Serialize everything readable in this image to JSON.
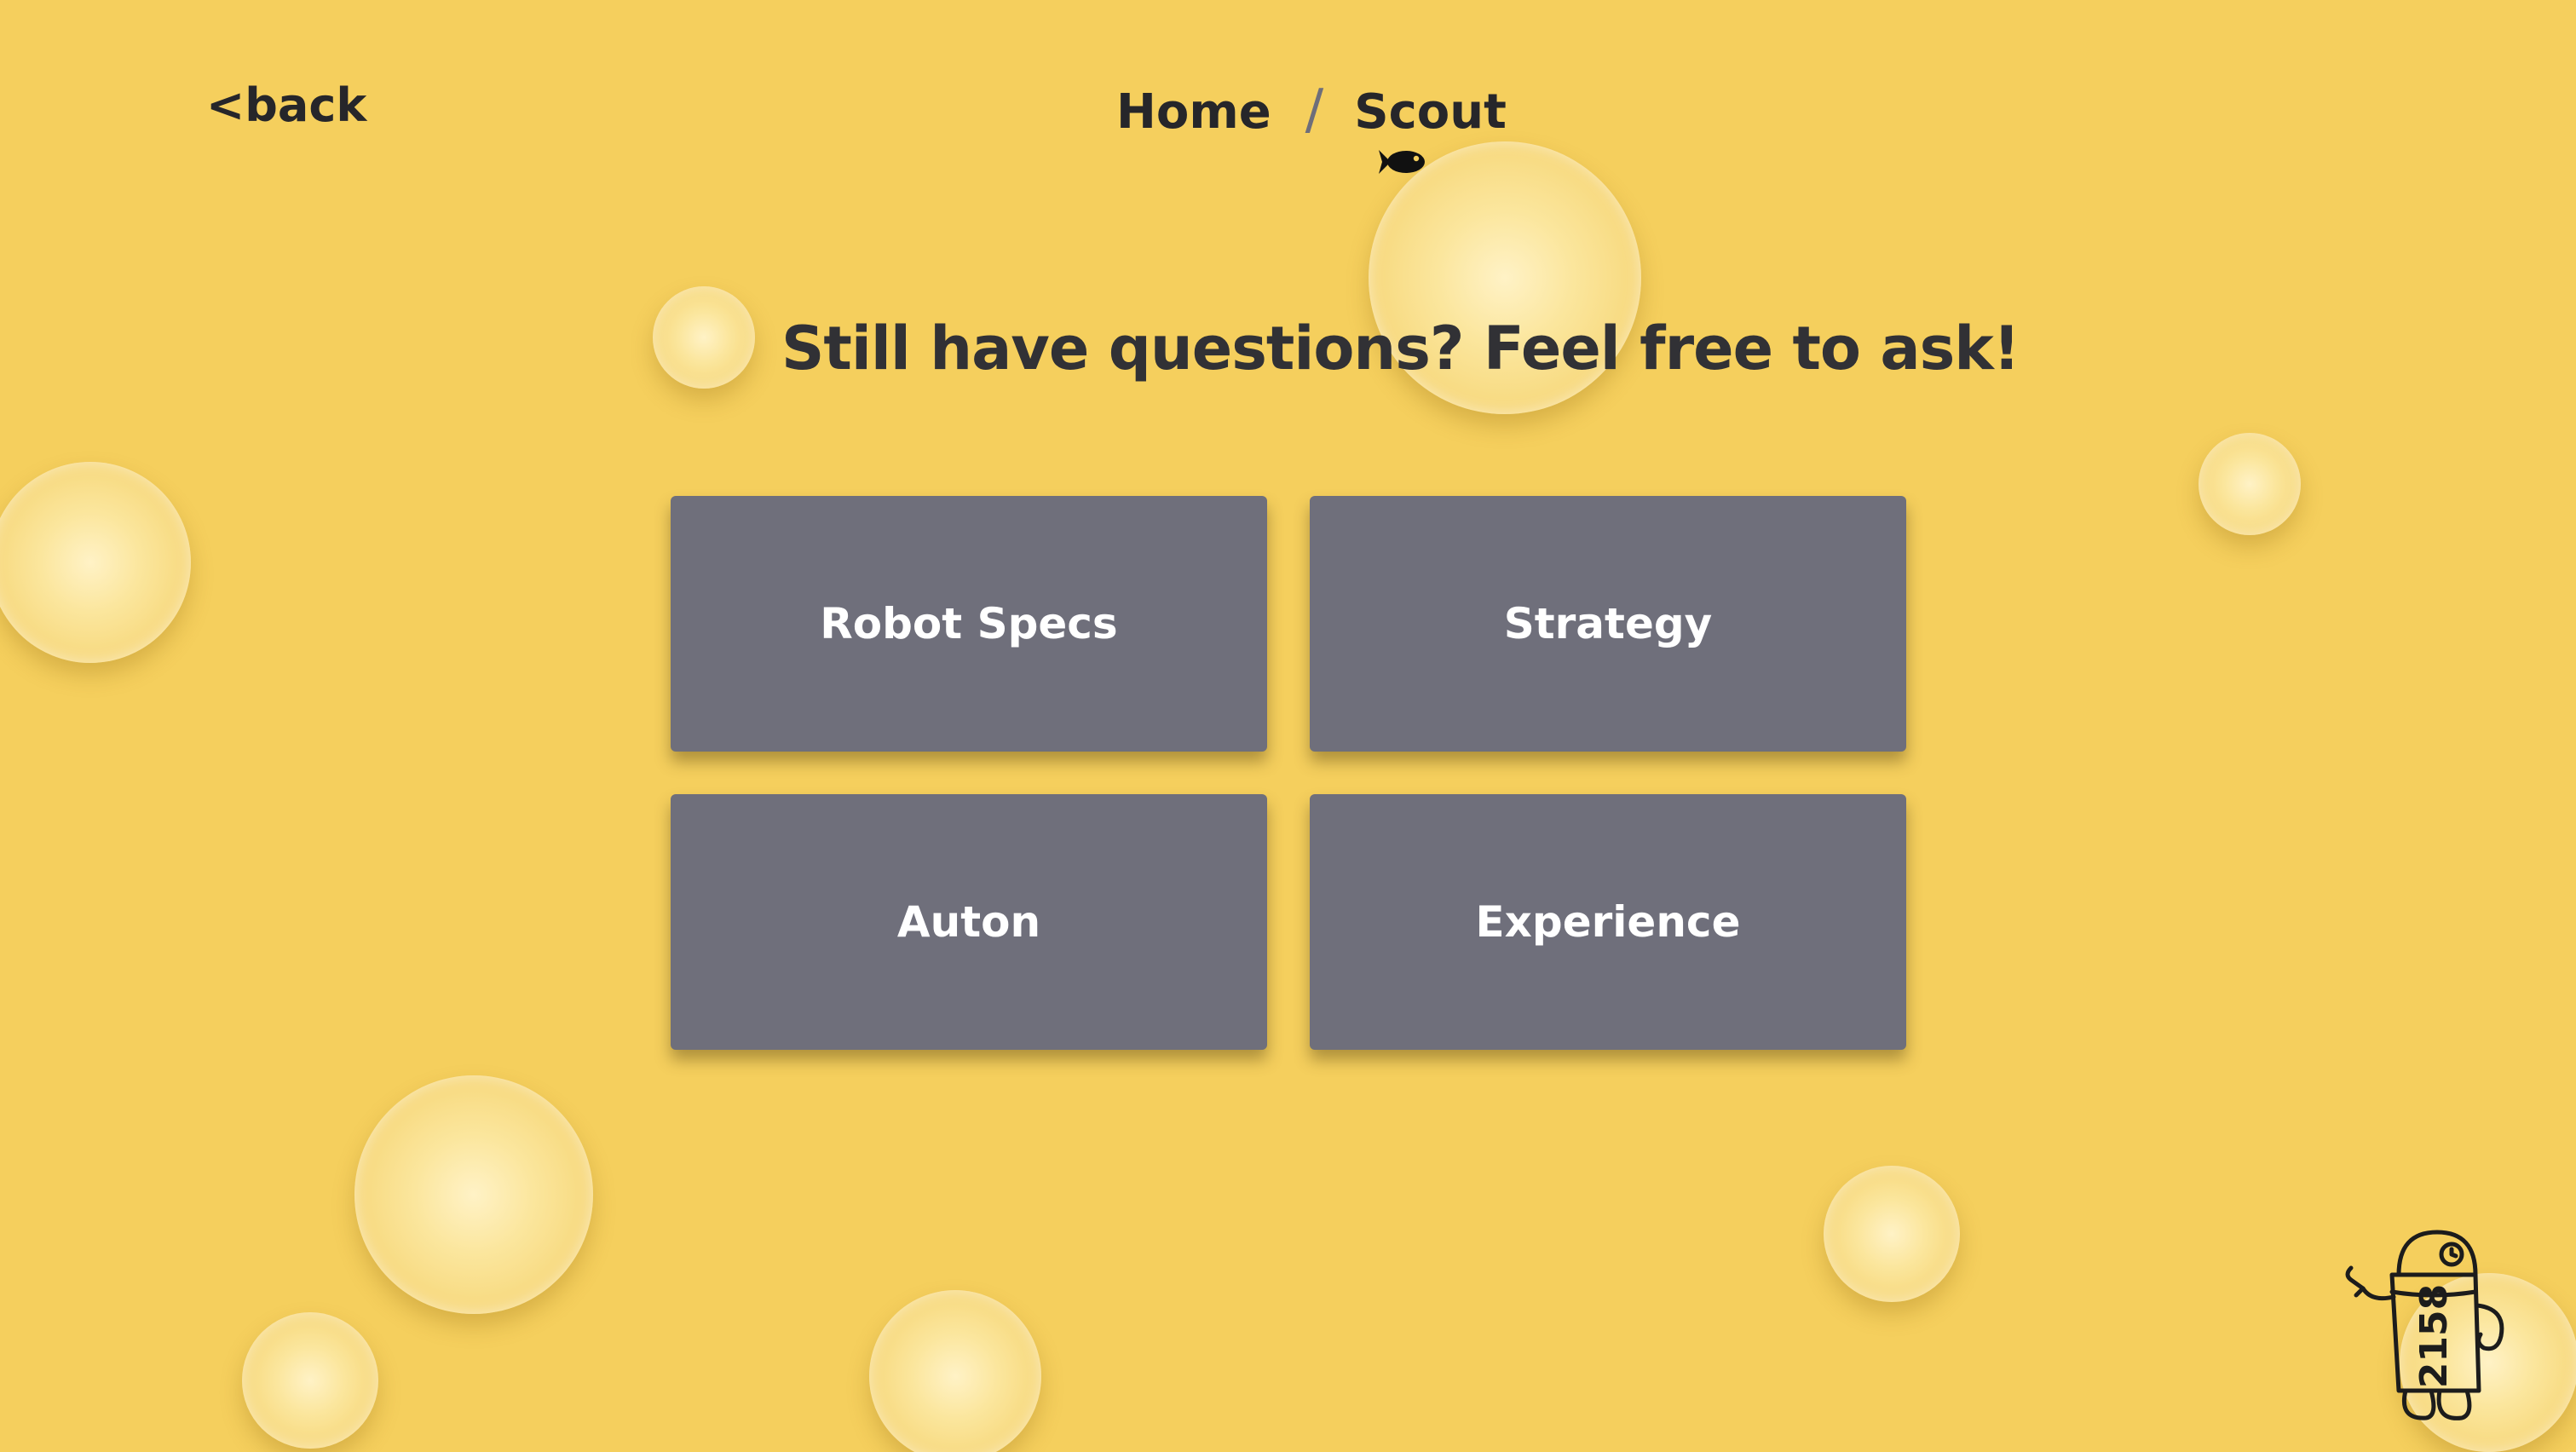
{
  "nav": {
    "back_label": "<back",
    "breadcrumb": {
      "home": "Home",
      "separator": "/",
      "current": "Scout"
    }
  },
  "main": {
    "heading": "Still have questions? Feel free to ask!",
    "tiles": [
      {
        "label": "Robot Specs"
      },
      {
        "label": "Strategy"
      },
      {
        "label": "Auton"
      },
      {
        "label": "Experience"
      }
    ]
  },
  "mascot": {
    "number": "2158",
    "icon": "robot-mascot-icon"
  },
  "icons": {
    "fish": "fish-icon"
  },
  "colors": {
    "background": "#f5cf5d",
    "tile": "#6f6f7b",
    "text_dark": "#26262a",
    "tile_text": "#ffffff"
  }
}
